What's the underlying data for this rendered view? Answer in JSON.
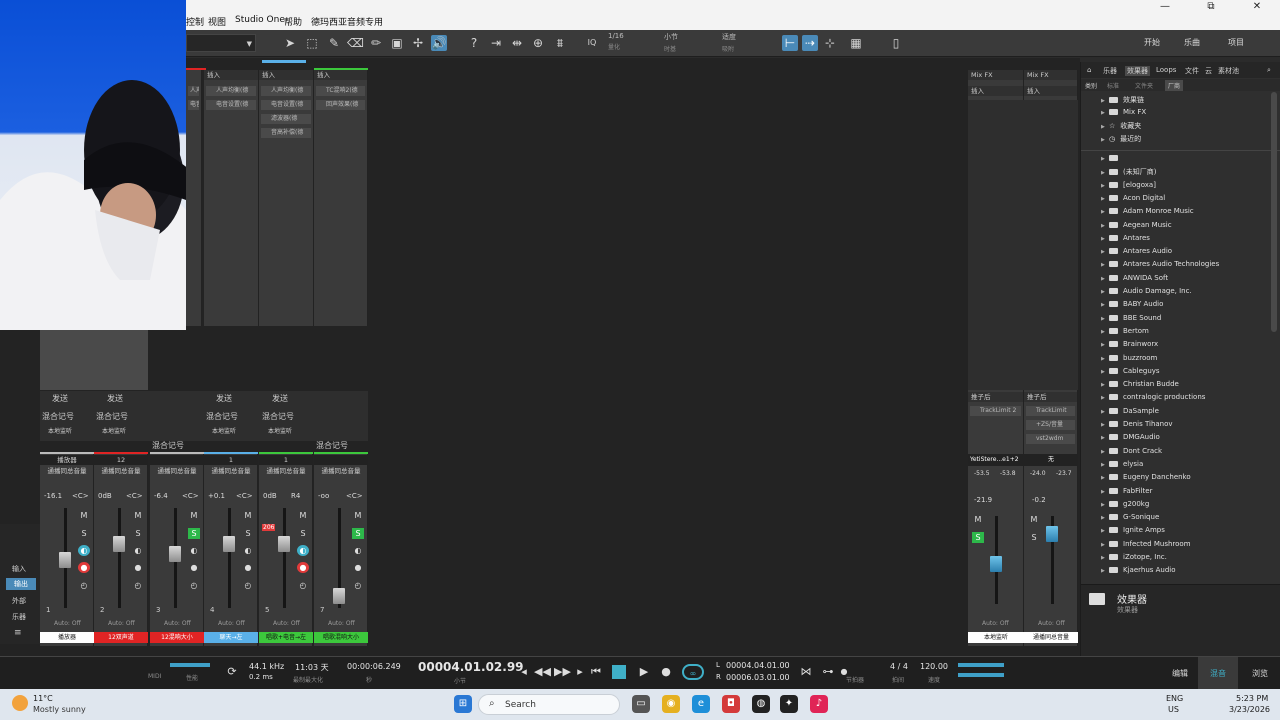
{
  "menubar": {
    "items": [
      "控制",
      "视图",
      "Studio One",
      "帮助",
      "德玛西亚音频专用"
    ],
    "window_controls": [
      "—",
      "⧉",
      "✕"
    ]
  },
  "toolbar": {
    "quantize_value": "1/16",
    "quantize_label": "量化",
    "timebase_value": "小节",
    "timebase_label": "时基",
    "snap_value": "适度",
    "snap_label": "吸附",
    "iq_label": "IQ",
    "modes": [
      "开始",
      "乐曲",
      "项目"
    ]
  },
  "mixer": {
    "insert_label": "插入",
    "send_label": "发送",
    "mix_label": "混合记号",
    "monitor_label": "本地监听",
    "auto_label": "Auto: Off",
    "channels": [
      {
        "num": "1",
        "name": "播放器",
        "input": "播放器",
        "route": "通播同总音量",
        "vol": "-16.1",
        "pan": "<C>",
        "name_color": "#ffffff",
        "name_text": "#111111",
        "meter_color": "#bbbbbb"
      },
      {
        "num": "2",
        "name": "12双声道",
        "input": "12",
        "route": "通播同总音量",
        "vol": "0dB",
        "pan": "<C>",
        "name_color": "#e02424",
        "name_text": "#ffffff",
        "meter_color": "#e02424"
      },
      {
        "num": "3",
        "name": "12混响大小",
        "input": "",
        "route": "通播同总音量",
        "vol": "-6.4",
        "pan": "<C>",
        "name_color": "#e02424",
        "name_text": "#ffffff",
        "meter_color": "#bbbbbb"
      },
      {
        "num": "4",
        "name": "聊天→左",
        "input": "1",
        "route": "通播同总音量",
        "vol": "+0.1",
        "pan": "<C>",
        "name_color": "#5ab0e8",
        "name_text": "#ffffff",
        "meter_color": "#5ab0e8"
      },
      {
        "num": "5",
        "name": "唱歌+电音→左",
        "input": "1",
        "route": "通播同总音量",
        "vol": "0dB",
        "pan": "R4",
        "name_color": "#3cc83c",
        "name_text": "#111111",
        "meter_color": "#3cc83c"
      },
      {
        "num": "7",
        "name": "唱歌混响大小",
        "input": "",
        "route": "通播同总音量",
        "vol": "-oo",
        "pan": "<C>",
        "name_color": "#3cc83c",
        "name_text": "#111111",
        "meter_color": "#3cc83c"
      }
    ],
    "plugins_ch2": [
      "人声均衡(德",
      "电音设置(德"
    ],
    "plugins_ch4": [
      "人声均衡(德",
      "电音设置(德",
      "滤波器(德",
      "音高补偿(德"
    ],
    "plugins_ch1": [
      "人声均衡(德",
      "电音设置(德"
    ],
    "plugins_ch5": [
      "TC混响2(德",
      "回声效果(德"
    ],
    "rec_value": "206",
    "bus": [
      {
        "name": "Mix FX",
        "output_name": "YetiStere...e1+2",
        "route": "本地监听",
        "vol": "-21.9",
        "meter_a": "-53.5",
        "meter_b": "-53.8",
        "post_slot": "TrackLimit 2"
      },
      {
        "name": "Mix FX",
        "output_name": "无",
        "route": "通播同总音量",
        "vol": "-0.2",
        "meter_a": "-24.0",
        "meter_b": "-23.7",
        "post_slot": "TrackLimit",
        "extra_slots": [
          "+ZS/音量",
          "vst2wdm"
        ]
      }
    ],
    "post_label": "推子后",
    "side_tabs": [
      "输入",
      "输出",
      "外部",
      "乐器"
    ]
  },
  "browser": {
    "tabs": [
      "乐器",
      "效果器",
      "Loops",
      "文件",
      "云",
      "素材池"
    ],
    "sort_label": "类别",
    "sort_options": [
      "标准",
      "文件夹",
      "厂商"
    ],
    "top_items": [
      "效果链",
      "Mix FX",
      "收藏夹",
      "最近的"
    ],
    "vendors": [
      "",
      "(未知厂商)",
      "[elogoxa]",
      "Acon Digital",
      "Adam Monroe Music",
      "Aegean Music",
      "Antares",
      "Antares Audio",
      "Antares Audio Technologies",
      "ANWIDA Soft",
      "Audio Damage, Inc.",
      "BABY Audio",
      "BBE Sound",
      "Bertom",
      "Brainworx",
      "buzzroom",
      "Cableguys",
      "Christian Budde",
      "contralogic productions",
      "DaSample",
      "Denis Tihanov",
      "DMGAudio",
      "Dont Crack",
      "elysia",
      "Eugeny Danchenko",
      "FabFilter",
      "g200kg",
      "G-Sonique",
      "Ignite Amps",
      "Infected Mushroom",
      "iZotope, Inc.",
      "Kjaerhus Audio"
    ],
    "info_title": "效果器",
    "info_sub": "效果器"
  },
  "transport": {
    "midi_label": "MIDI",
    "perf_label": "性能",
    "sample_rate": "44.1 kHz",
    "latency": "0.2 ms",
    "record_time": "11:03 天",
    "record_label": "最制最大化",
    "time_seconds": "00:00:06.249",
    "time_seconds_label": "秒",
    "position": "00004.01.02.99",
    "position_label": "小节",
    "loop_L": "00004.04.01.00",
    "loop_R": "00006.03.01.00",
    "metronome_label": "节拍器",
    "signature": "4 / 4",
    "signature_label": "拍间",
    "tempo": "120.00",
    "tempo_label": "速度",
    "views": [
      "编辑",
      "混音",
      "浏览"
    ]
  },
  "taskbar": {
    "weather_temp": "11°C",
    "weather_desc": "Mostly sunny",
    "search_placeholder": "Search",
    "lang": "ENG",
    "region": "US",
    "time": "5:23 PM",
    "date": "3/23/2026"
  }
}
